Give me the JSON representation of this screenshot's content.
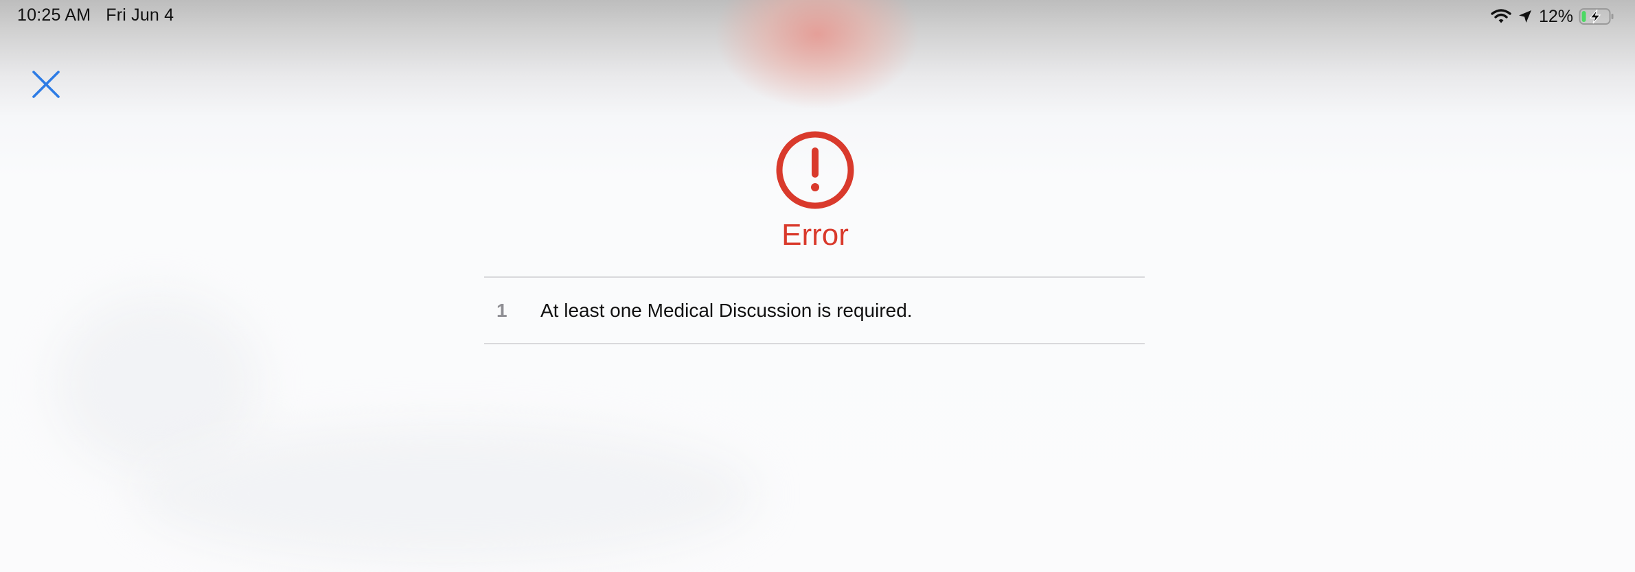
{
  "status_bar": {
    "time": "10:25 AM",
    "date": "Fri Jun 4",
    "battery_percent": "12%",
    "icons": [
      "wifi-icon",
      "location-arrow-icon",
      "battery-charging-icon"
    ]
  },
  "close_button": {
    "icon": "close-icon"
  },
  "error": {
    "icon": "exclamation-circle-icon",
    "title": "Error",
    "items": [
      {
        "index": "1",
        "message": "At least one Medical Discussion is required."
      }
    ]
  },
  "colors": {
    "accent_blue": "#2c7be5",
    "error_red": "#d93a2c"
  }
}
